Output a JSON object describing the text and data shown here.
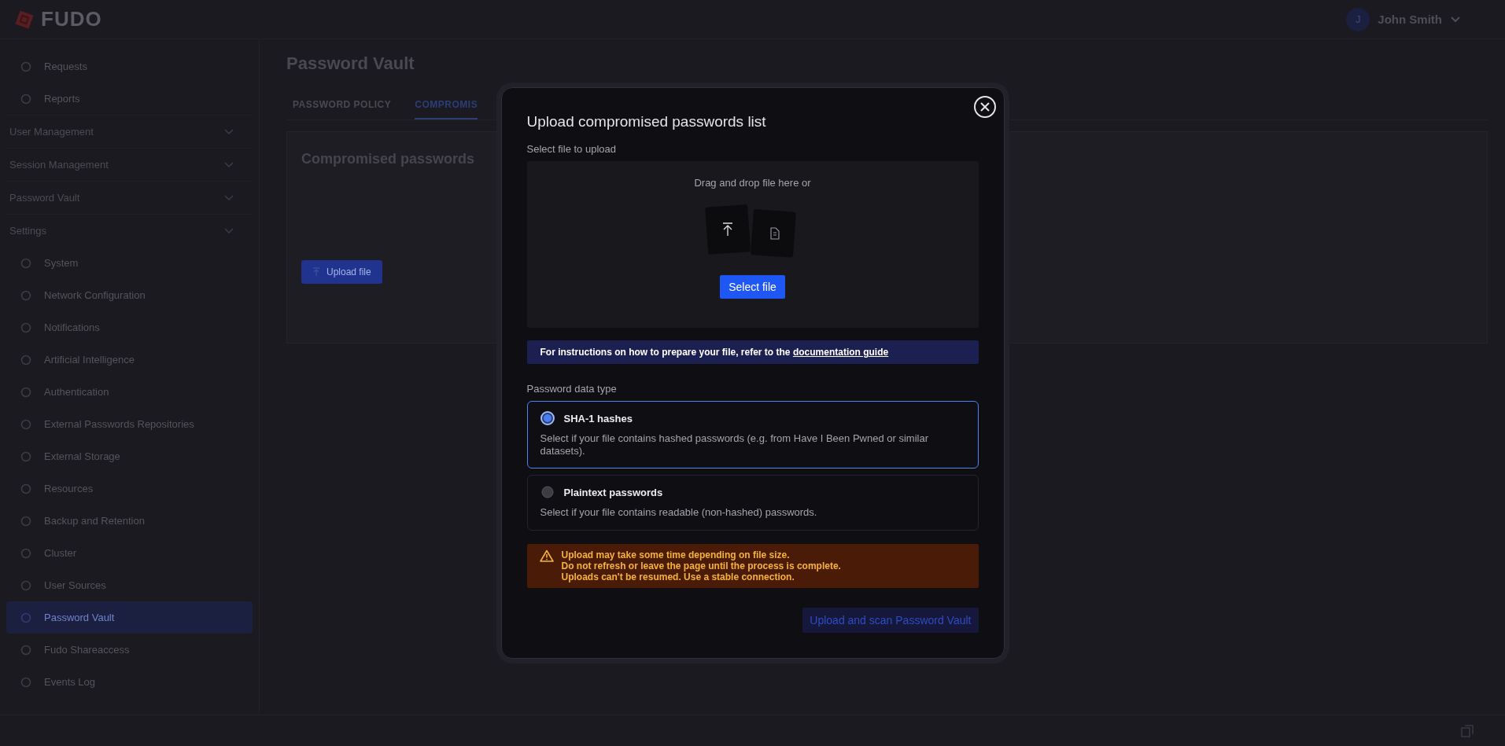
{
  "header": {
    "logo": "FUDO",
    "user": {
      "initial": "J",
      "name": "John Smith"
    }
  },
  "sidebar": {
    "items": [
      {
        "kind": "link",
        "label": "Requests",
        "selected": false
      },
      {
        "kind": "link",
        "label": "Reports",
        "selected": false
      },
      {
        "kind": "group",
        "label": "User Management"
      },
      {
        "kind": "group",
        "label": "Session Management"
      },
      {
        "kind": "group",
        "label": "Password Vault"
      },
      {
        "kind": "group",
        "label": "Settings"
      },
      {
        "kind": "link",
        "label": "System",
        "selected": false
      },
      {
        "kind": "link",
        "label": "Network Configuration",
        "selected": false
      },
      {
        "kind": "link",
        "label": "Notifications",
        "selected": false
      },
      {
        "kind": "link",
        "label": "Artificial Intelligence",
        "selected": false
      },
      {
        "kind": "link",
        "label": "Authentication",
        "selected": false
      },
      {
        "kind": "link",
        "label": "External Passwords Repositories",
        "selected": false
      },
      {
        "kind": "link",
        "label": "External Storage",
        "selected": false
      },
      {
        "kind": "link",
        "label": "Resources",
        "selected": false
      },
      {
        "kind": "link",
        "label": "Backup and Retention",
        "selected": false
      },
      {
        "kind": "link",
        "label": "Cluster",
        "selected": false
      },
      {
        "kind": "link",
        "label": "User Sources",
        "selected": false
      },
      {
        "kind": "link",
        "label": "Password Vault",
        "selected": true
      },
      {
        "kind": "link",
        "label": "Fudo Shareaccess",
        "selected": false
      },
      {
        "kind": "link",
        "label": "Events Log",
        "selected": false
      }
    ]
  },
  "page": {
    "title": "Password Vault",
    "tabs": [
      {
        "label": "PASSWORD POLICY",
        "selected": false
      },
      {
        "label": "COMPROMIS",
        "selected": true
      }
    ],
    "card": {
      "title": "Compromised passwords",
      "button": "Upload file"
    }
  },
  "modal": {
    "title": "Upload compromised passwords list",
    "file_label": "Select file to upload",
    "dropzone": {
      "text": "Drag and drop file here or",
      "button": "Select file"
    },
    "info": {
      "text": "For instructions on how to prepare your file, refer to the ",
      "link": "documentation guide"
    },
    "type_label": "Password data type",
    "options": [
      {
        "title": "SHA-1 hashes",
        "description": "Select if your file contains hashed passwords (e.g. from Have I Been Pwned or similar datasets).",
        "selected": true
      },
      {
        "title": "Plaintext passwords",
        "description": "Select if your file contains readable (non-hashed) passwords.",
        "selected": false
      }
    ],
    "warning": [
      "Upload may take some time depending on file size.",
      "Do not refresh or leave the page until the process is complete.",
      "Uploads can't be resumed. Use a stable connection."
    ],
    "submit": {
      "label": "Upload and scan Password Vault",
      "disabled": true
    }
  }
}
